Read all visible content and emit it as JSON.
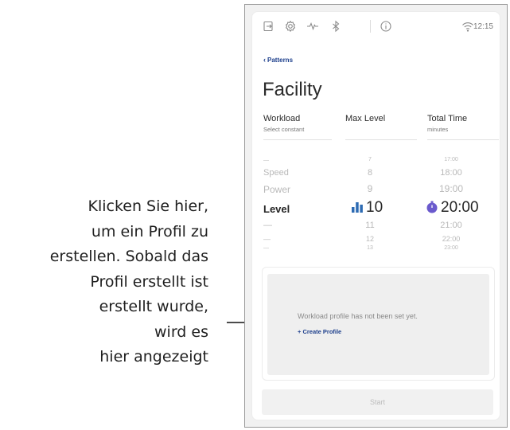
{
  "callout": {
    "lines": [
      "Klicken Sie hier,",
      "um ein Profil zu",
      "erstellen. Sobald das",
      "Profil erstellt ist",
      "erstellt wurde,",
      "wird es",
      "hier angezeigt"
    ]
  },
  "statusbar": {
    "icons": [
      "exit-icon",
      "settings-icon",
      "heart-rate-icon",
      "bluetooth-icon",
      "info-icon",
      "wifi-icon"
    ],
    "time": "12:15"
  },
  "nav": {
    "back_label": "Patterns"
  },
  "page": {
    "title": "Facility"
  },
  "columns": [
    {
      "heading": "Workload",
      "sub": "Select constant"
    },
    {
      "heading": "Max Level",
      "sub": ""
    },
    {
      "heading": "Total Time",
      "sub": "minutes"
    }
  ],
  "picker": {
    "workload_options": [
      "—",
      "Speed",
      "Power",
      "Level",
      "—",
      "—",
      "—"
    ],
    "level_values": [
      "7",
      "8",
      "9",
      "10",
      "11",
      "12",
      "13"
    ],
    "time_values": [
      "17:00",
      "18:00",
      "19:00",
      "20:00",
      "21:00",
      "22:00",
      "23:00"
    ],
    "selected": {
      "workload": "Level",
      "level": "10",
      "time": "20:00"
    }
  },
  "profile": {
    "empty_message": "Workload profile has not been set yet.",
    "create_label": "+ Create Profile"
  },
  "actions": {
    "start_label": "Start"
  },
  "colors": {
    "accent_blue": "#1d3f8c",
    "level_icon": "#2d6bb3",
    "timer_icon": "#6a5acd"
  }
}
